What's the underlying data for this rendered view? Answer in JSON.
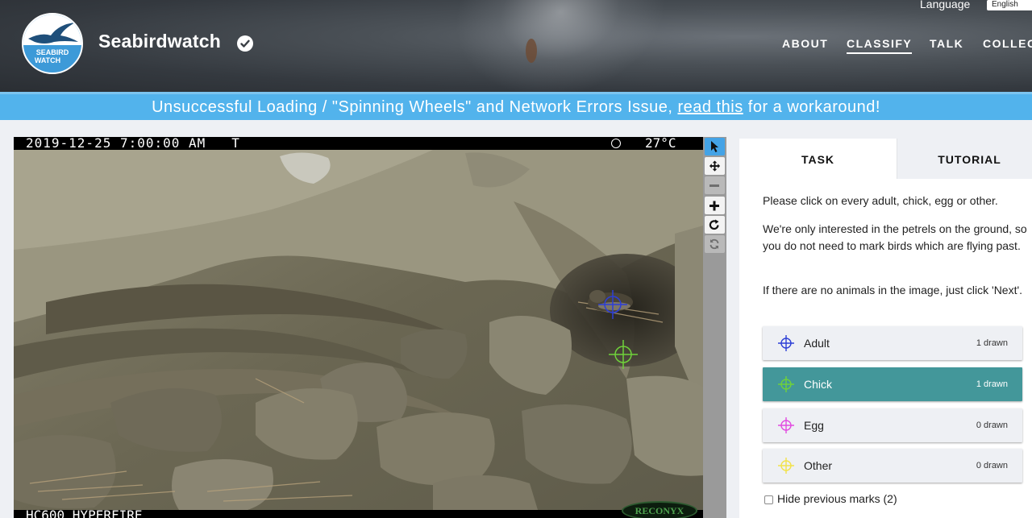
{
  "header": {
    "logo_line1": "SEABIRD",
    "logo_line2": "WATCH",
    "project_title": "Seabirdwatch",
    "language_label": "Language",
    "language_value": "English",
    "nav": [
      {
        "label": "ABOUT"
      },
      {
        "label": "CLASSIFY"
      },
      {
        "label": "TALK"
      },
      {
        "label": "COLLECT"
      }
    ]
  },
  "banner": {
    "before": "Unsuccessful Loading / \"Spinning Wheels\" and Network Errors Issue, ",
    "link": "read this",
    "after": " for a workaround!"
  },
  "camera": {
    "datetime": "2019-12-25 7:00:00 AM   T",
    "temperature": "27°C",
    "model": "HC600 HYPERFIRE",
    "brand": "RECONYX"
  },
  "tabs": {
    "task": "TASK",
    "tutorial": "TUTORIAL"
  },
  "instructions": [
    "Please click on every adult, chick, egg or other.",
    "We're only interested in the petrels on the ground, so you do not need to mark birds which are flying past.",
    "If there are no animals in the image, just click 'Next'."
  ],
  "answers": [
    {
      "label": "Adult",
      "count": "1 drawn",
      "color": "#2d3fd6"
    },
    {
      "label": "Chick",
      "count": "1 drawn",
      "color": "#6fd13a"
    },
    {
      "label": "Egg",
      "count": "0 drawn",
      "color": "#e24ce0"
    },
    {
      "label": "Other",
      "count": "0 drawn",
      "color": "#f2e24a"
    }
  ],
  "hide_marks_label": "Hide previous marks (2)",
  "colors": {
    "banner": "#52b3ec",
    "selected_answer": "#43979a",
    "toolbar_active": "#44a3e6"
  }
}
